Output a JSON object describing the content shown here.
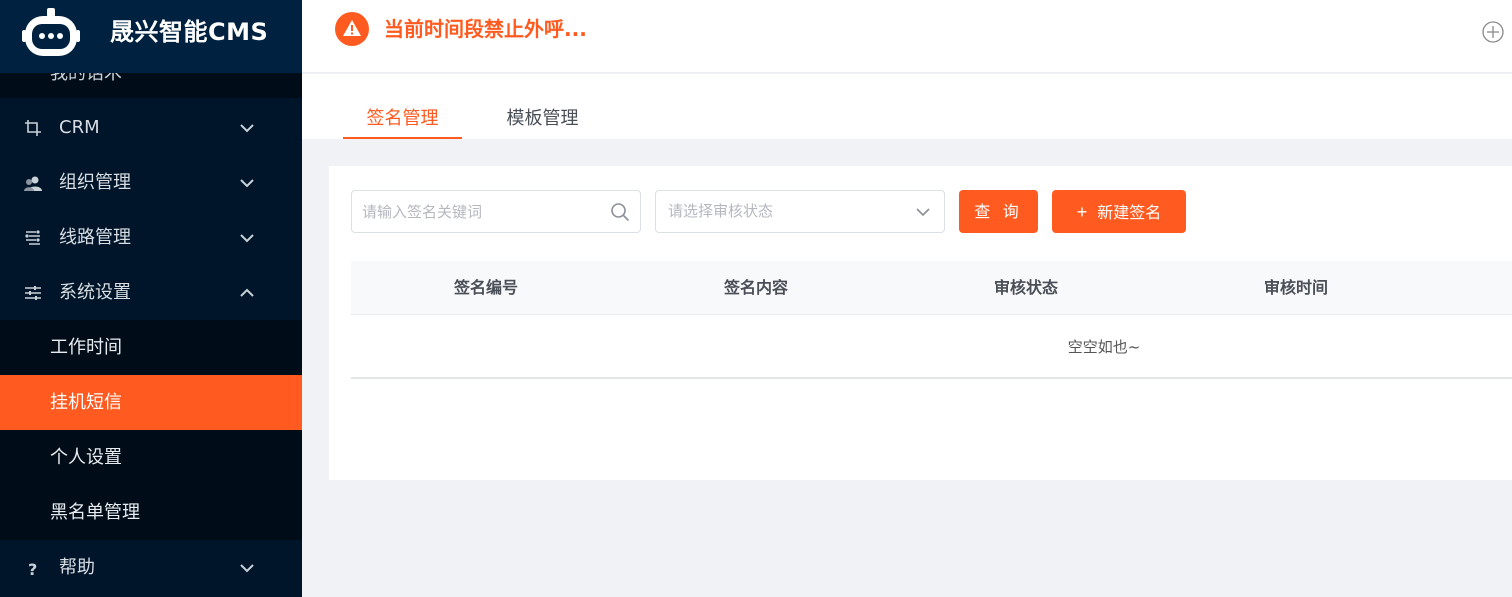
{
  "app": {
    "title": "晟兴智能CMS",
    "accent": "#ff5a1f",
    "sidebar_bg": "#001529"
  },
  "header": {
    "warning_text": "当前时间段禁止外呼..."
  },
  "sidebar": {
    "partial_item": "我的话术",
    "items": [
      {
        "label": "CRM",
        "icon": "crop-icon"
      },
      {
        "label": "组织管理",
        "icon": "users-icon"
      },
      {
        "label": "线路管理",
        "icon": "route-icon"
      },
      {
        "label": "系统设置",
        "icon": "sliders-icon",
        "expanded": true
      }
    ],
    "subitems": [
      {
        "label": "工作时间"
      },
      {
        "label": "挂机短信",
        "active": true
      },
      {
        "label": "个人设置"
      },
      {
        "label": "黑名单管理"
      }
    ],
    "help": {
      "label": "帮助",
      "icon": "question-icon"
    }
  },
  "tabs": [
    {
      "label": "签名管理",
      "active": true
    },
    {
      "label": "模板管理",
      "active": false
    }
  ],
  "filters": {
    "keyword_placeholder": "请输入签名关键词",
    "status_placeholder": "请选择审核状态",
    "query_label": "查 询",
    "new_label": "新建签名"
  },
  "table": {
    "columns": [
      "签名编号",
      "签名内容",
      "审核状态",
      "审核时间"
    ],
    "empty_text": "空空如也~"
  }
}
